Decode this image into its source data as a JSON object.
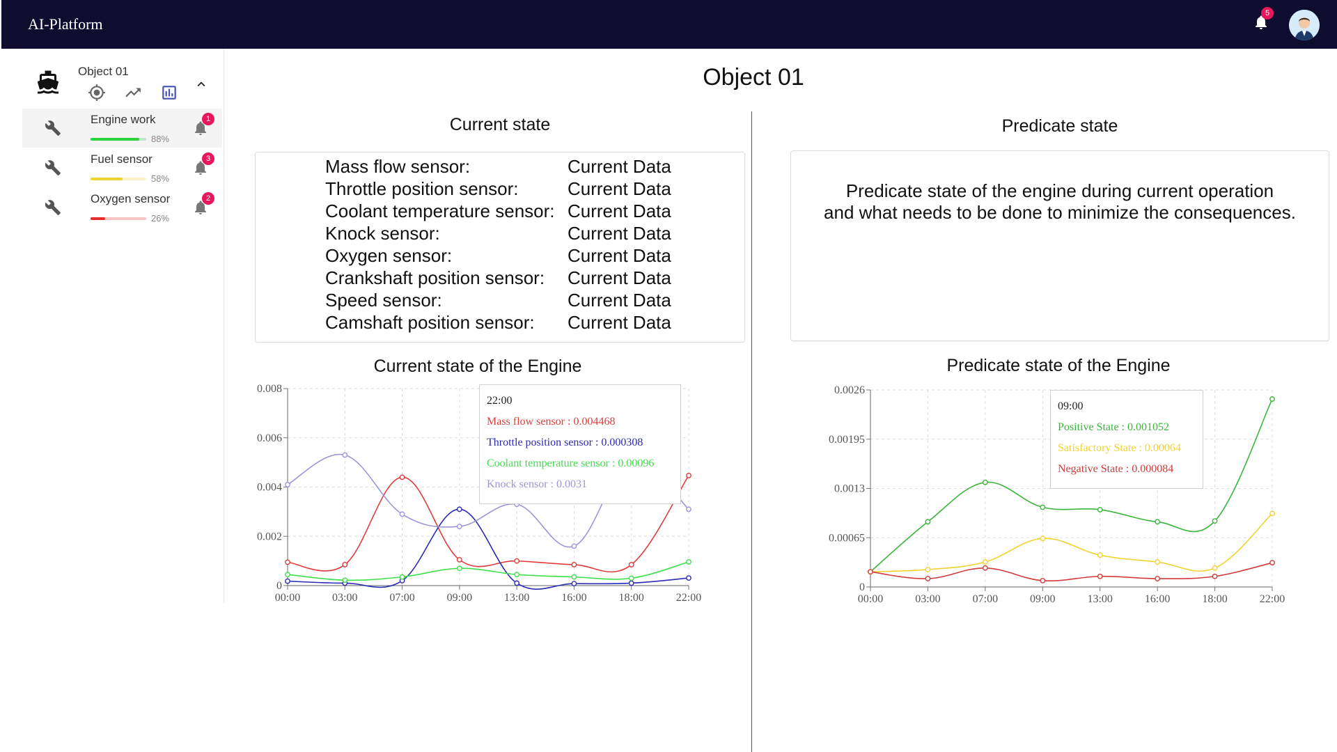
{
  "app": {
    "title": "AI-Platform",
    "notification_count": "5"
  },
  "sidebar": {
    "object_name": "Object 01",
    "tools": [
      "target-icon",
      "trending-up-icon",
      "bar-chart-icon"
    ],
    "items": [
      {
        "label": "Engine work",
        "percent_label": "88%",
        "progress": 0.88,
        "color": "#2bd23a",
        "alerts": "1"
      },
      {
        "label": "Fuel sensor",
        "percent_label": "58%",
        "progress": 0.58,
        "color": "#f2d230",
        "alerts": "3"
      },
      {
        "label": "Oxygen sensor",
        "percent_label": "26%",
        "progress": 0.26,
        "color": "#e82b2b",
        "alerts": "2"
      }
    ]
  },
  "main": {
    "title": "Object 01",
    "current": {
      "title": "Current state",
      "rows": [
        {
          "name": "Mass flow sensor:",
          "value": "Current Data"
        },
        {
          "name": "Throttle position sensor:",
          "value": "Current Data"
        },
        {
          "name": "Coolant temperature sensor:",
          "value": "Current Data"
        },
        {
          "name": "Knock sensor:",
          "value": "Current Data"
        },
        {
          "name": "Oxygen sensor:",
          "value": "Current Data"
        },
        {
          "name": "Crankshaft position sensor:",
          "value": "Current Data"
        },
        {
          "name": "Speed sensor:",
          "value": "Current Data"
        },
        {
          "name": "Camshaft position sensor:",
          "value": "Current Data"
        }
      ]
    },
    "predicate": {
      "title": "Predicate state",
      "text_line1": "Predicate state of the engine during current operation",
      "text_line2": "and what needs to be done to minimize the consequences."
    }
  },
  "chart_data": [
    {
      "type": "line",
      "title": "Current state of the Engine",
      "x": [
        "00:00",
        "03:00",
        "07:00",
        "09:00",
        "13:00",
        "16:00",
        "18:00",
        "22:00"
      ],
      "y_ticks": [
        "0",
        "0.002",
        "0.004",
        "0.006",
        "0.008"
      ],
      "ylim": [
        0,
        0.008
      ],
      "grid": true,
      "series": [
        {
          "name": "Mass flow sensor",
          "color": "#e03c3c",
          "values": [
            0.00095,
            0.00085,
            0.0044,
            0.00105,
            0.001,
            0.00085,
            0.00085,
            0.004468
          ]
        },
        {
          "name": "Throttle position sensor",
          "color": "#2b2bb5",
          "values": [
            0.00018,
            0.0001,
            0.0002,
            0.0031,
            0.0001,
            8e-05,
            0.0001,
            0.000308
          ]
        },
        {
          "name": "Coolant temperature sensor",
          "color": "#3ee04a",
          "values": [
            0.00045,
            0.00022,
            0.00035,
            0.0007,
            0.00045,
            0.00035,
            0.0003,
            0.00096
          ]
        },
        {
          "name": "Knock sensor",
          "color": "#9b96d8",
          "values": [
            0.0041,
            0.0053,
            0.0029,
            0.0024,
            0.0033,
            0.0016,
            0.0051,
            0.0031
          ]
        }
      ],
      "tooltip": {
        "time": "22:00",
        "lines": [
          "Mass flow sensor : 0.004468",
          "Throttle position sensor : 0.000308",
          "Coolant temperature sensor : 0.00096",
          "Knock sensor : 0.0031"
        ]
      }
    },
    {
      "type": "line",
      "title": "Predicate state of the Engine",
      "x": [
        "00:00",
        "03:00",
        "07:00",
        "09:00",
        "13:00",
        "16:00",
        "18:00",
        "22:00"
      ],
      "y_ticks": [
        "0",
        "0.00065",
        "0.0013",
        "0.00195",
        "0.0026"
      ],
      "ylim": [
        0,
        0.0026
      ],
      "grid": true,
      "series": [
        {
          "name": "Positive State",
          "color": "#3ab53a",
          "values": [
            0.0002,
            0.00086,
            0.00138,
            0.001052,
            0.00102,
            0.00086,
            0.00087,
            0.00248
          ]
        },
        {
          "name": "Satisfactory State",
          "color": "#f2d230",
          "values": [
            0.0002,
            0.00023,
            0.00033,
            0.00064,
            0.00042,
            0.00033,
            0.00025,
            0.00097
          ]
        },
        {
          "name": "Negative State",
          "color": "#d23a3a",
          "values": [
            0.0002,
            0.00011,
            0.00025,
            8.4e-05,
            0.00014,
            0.00011,
            0.00014,
            0.00032
          ]
        }
      ],
      "tooltip": {
        "time": "09:00",
        "lines": [
          "Positive State : 0.001052",
          "Satisfactory State : 0.00064",
          "Negative State : 0.000084"
        ]
      }
    }
  ]
}
